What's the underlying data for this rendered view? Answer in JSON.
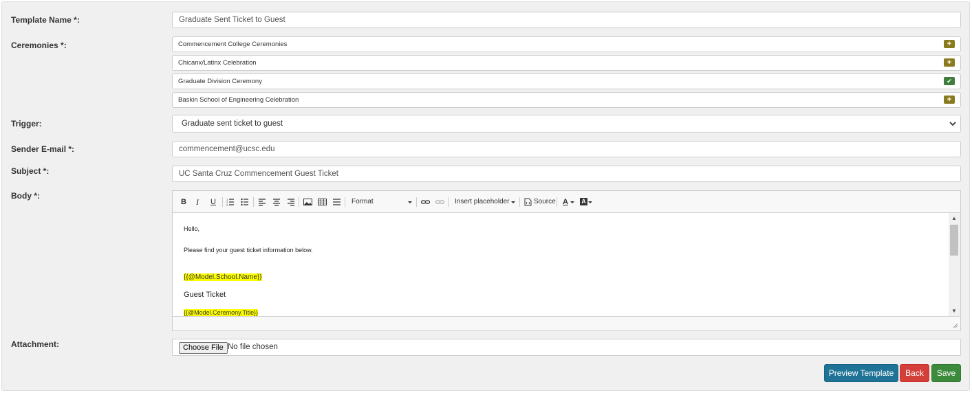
{
  "form": {
    "template_name_label": "Template Name *:",
    "template_name_value": "Graduate Sent Ticket to Guest",
    "ceremonies_label": "Ceremonies *:",
    "ceremonies": [
      {
        "name": "Commencement College Ceremonies",
        "state": "add",
        "icon": "+"
      },
      {
        "name": "Chicanx/Latinx Celebration",
        "state": "add",
        "icon": "+"
      },
      {
        "name": "Graduate Division Ceremony",
        "state": "selected",
        "icon": "✔"
      },
      {
        "name": "Baskin School of Engineering Celebration",
        "state": "add",
        "icon": "+"
      }
    ],
    "trigger_label": "Trigger:",
    "trigger_value": "Graduate sent ticket to guest",
    "sender_label": "Sender E-mail *:",
    "sender_value": "commencement@ucsc.edu",
    "subject_label": "Subject *:",
    "subject_value": "UC Santa Cruz Commencement Guest Ticket",
    "body_label": "Body *:",
    "attachment_label": "Attachment:",
    "choose_file": "Choose File",
    "no_file": "No file chosen"
  },
  "editor": {
    "toolbar": {
      "bold": "B",
      "italic": "I",
      "underline": "U",
      "format": "Format",
      "insert_placeholder": "Insert placeholder",
      "source": "Source",
      "text_color": "A",
      "bg_color": "A"
    },
    "content": {
      "line1": "Hello,",
      "line2": "Please find your guest ticket information below.",
      "placeholder1": "{{@Model.School.Name}}",
      "line3": "Guest Ticket",
      "placeholder2": "{{@Model.Ceremony.Title}}"
    }
  },
  "buttons": {
    "preview": "Preview Template",
    "back": "Back",
    "save": "Save"
  },
  "colors": {
    "preview": "#1f7396",
    "back": "#d43f3a",
    "save": "#3c8a3c",
    "add_icon": "#8a7a1e",
    "selected_icon": "#3e7d3e",
    "highlight": "#ffff00"
  }
}
